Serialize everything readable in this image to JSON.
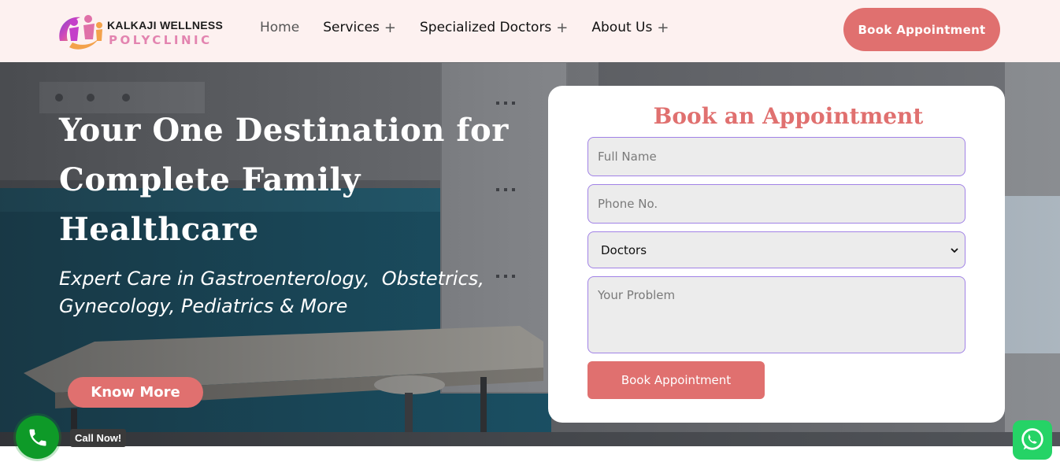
{
  "brand": {
    "name_top": "KALKAJI WELLNESS",
    "name_bottom": "POLYCLINIC",
    "accent_color": "#e0706f",
    "logo_colors": [
      "#c43ec9",
      "#e384b0",
      "#f4a64a"
    ]
  },
  "nav": {
    "items": [
      {
        "label": "Home",
        "has_submenu": false
      },
      {
        "label": "Services",
        "has_submenu": true
      },
      {
        "label": "Specialized Doctors",
        "has_submenu": true
      },
      {
        "label": "About Us",
        "has_submenu": true
      }
    ],
    "submenu_icon": "+",
    "cta_label": "Book Appointment"
  },
  "hero": {
    "title_lines": [
      "Your One Destination for",
      "Complete Family",
      "Healthcare"
    ],
    "subtitle_lines": [
      "Expert Care in Gastroenterology,  Obstetrics,",
      "Gynecology, Pediatrics & More"
    ],
    "button_label": "Know More"
  },
  "form": {
    "title": "Book an Appointment",
    "name_placeholder": "Full Name",
    "phone_placeholder": "Phone No.",
    "doctor_select_value": "Doctors",
    "problem_placeholder": "Your Problem",
    "submit_label": "Book Appointment"
  },
  "widgets": {
    "call_label": "Call Now!",
    "call_icon": "phone-icon",
    "whatsapp_icon": "whatsapp-icon",
    "call_color": "#0e9a28",
    "whatsapp_color": "#25d366"
  }
}
